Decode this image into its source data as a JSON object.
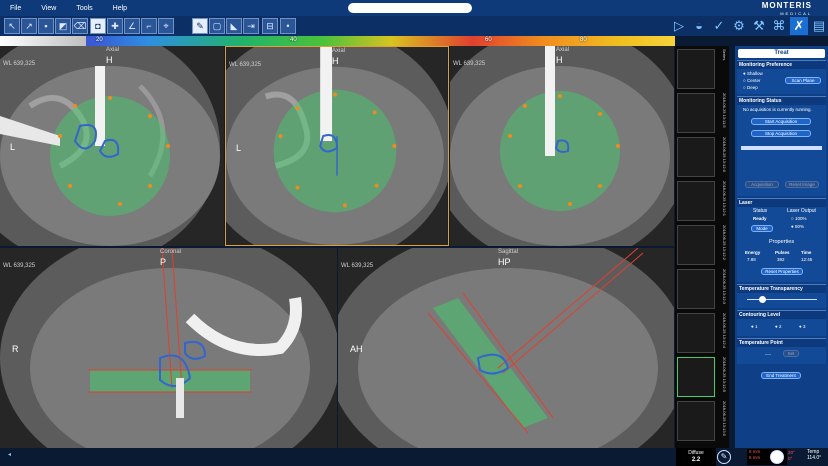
{
  "menu": {
    "file": "File",
    "view": "View",
    "tools": "Tools",
    "help": "Help"
  },
  "logo": {
    "name": "MONTERIS",
    "sub": "MEDICAL"
  },
  "toolbar": {
    "icons": [
      "cursor-icon",
      "cursor-alt-icon",
      "window-level-icon",
      "pan-icon",
      "eraser-icon",
      "ruler-icon",
      "camera-icon",
      "crosshair-icon",
      "angle-icon",
      "line-icon",
      "probe-icon",
      "fill-icon",
      "region-icon",
      "laser-icon",
      "arrow-icon",
      "grid-icon",
      "dot-icon"
    ],
    "right_icons": [
      "play-icon",
      "plan-icon",
      "probe-insert-icon",
      "settings-icon",
      "document-icon"
    ]
  },
  "scale": {
    "marks": [
      "20",
      "40",
      "60",
      "80"
    ]
  },
  "views": {
    "v1": {
      "wl": "WL 639,325",
      "top_label": "H",
      "side_label": "L",
      "axis": "Axial"
    },
    "v2": {
      "wl": "WL 639,325",
      "top_label": "H",
      "side_label": "L",
      "axis": "Axial"
    },
    "v3": {
      "wl": "WL 639,325",
      "top_label": "H",
      "axis": "Axial"
    },
    "v4": {
      "wl": "WL 639,325",
      "top_label": "P",
      "side_label": "R",
      "axis": "Coronal"
    },
    "v5": {
      "wl": "WL 639,325",
      "top_label": "HP",
      "side_label": "AH",
      "axis": "Sagittal"
    }
  },
  "thumbs": {
    "labels": [
      "Series",
      "2018-06-25 13:11:5",
      "2018-06-25 13:12:0",
      "2018-06-25 13:12:1",
      "2018-06-25 13:12:2",
      "2018-06-25 13:12:3",
      "2018-06-25 13:12:4",
      "2018-06-25 13:12:5",
      "2018-06-25 13:13:0"
    ]
  },
  "panel": {
    "tab": "Treat",
    "monitoring_pref": {
      "title": "Monitoring Preference",
      "options": [
        "Shallow",
        "Center",
        "Deep"
      ],
      "scan_btn": "Scan Plane"
    },
    "monitoring_status": {
      "title": "Monitoring Status",
      "msg": "No acquisition is currently running.",
      "start_btn": "Start Acquisition",
      "stop_btn": "Stop Acquisition",
      "dim1": "Acquisition",
      "dim2": "Reset Image"
    },
    "laser": {
      "title": "Laser",
      "status_label": "Status",
      "status_value": "Ready",
      "mode_btn": "Mode",
      "output_label": "Laser Output",
      "output_opts": [
        "100%",
        "80%"
      ],
      "properties_label": "Properties",
      "cols": [
        "Energy",
        "Pulses",
        "Time"
      ],
      "vals": [
        "7.88",
        "392",
        "12:45"
      ],
      "reset_btn": "Reset Properties"
    },
    "temp_transparency": {
      "title": "Temperature Transparency"
    },
    "contouring": {
      "title": "Contouring Level",
      "opts": [
        "1",
        "2",
        "3"
      ]
    },
    "temp_point": {
      "title": "Temperature Point",
      "value": "----",
      "set_btn": "Set"
    },
    "end_btn": "End Treatment"
  },
  "bottom": {
    "diffuse_label": "Diffuse",
    "diffuse_value": "2.2",
    "mm1": "6 mm",
    "mm2": "6 mm",
    "deg1": "20°",
    "deg2": "0°",
    "temp_label": "Temp",
    "temp_value": "114.0°"
  },
  "colors": {
    "accent": "#1b6fd2",
    "panel": "#0f3f86",
    "ablation": "#3fd06a",
    "probe": "#e04030"
  }
}
